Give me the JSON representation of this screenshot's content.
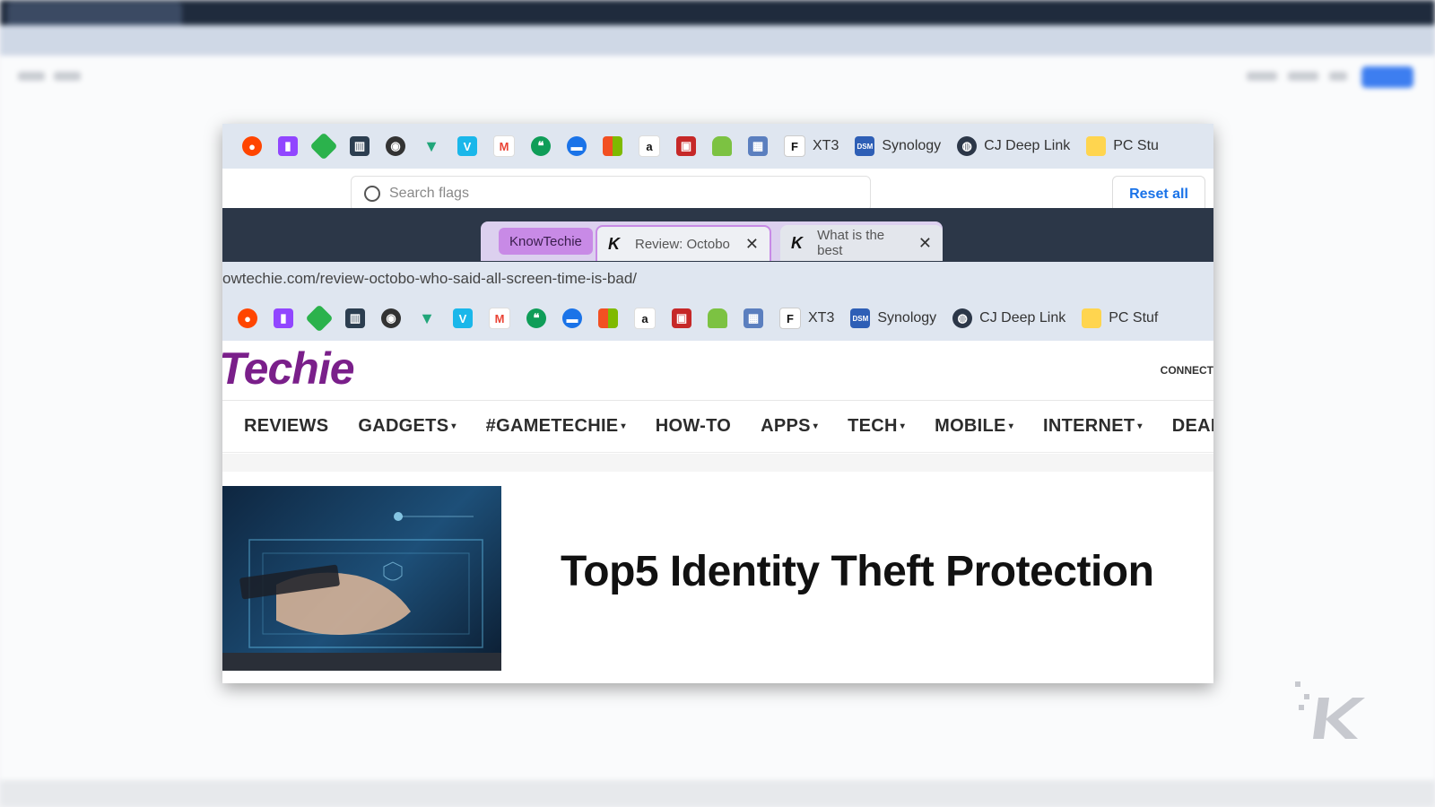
{
  "bookmarks_bar": {
    "icons": [
      "reddit-icon",
      "twitch-icon",
      "feedly-icon",
      "tiles-icon",
      "hootsuite-icon",
      "vuetify-icon",
      "vimeo-icon",
      "gmail-icon",
      "hangouts-icon",
      "chat-bubble-icon",
      "microsoft-icon",
      "amazon-icon",
      "gift-icon",
      "android-icon",
      "calendar-icon"
    ],
    "items": [
      {
        "icon": "f-icon",
        "label": "XT3"
      },
      {
        "icon": "dsm-icon",
        "label": "Synology"
      },
      {
        "icon": "globe-icon",
        "label": "CJ Deep Link"
      },
      {
        "icon": "folder-icon",
        "label": "PC Stu"
      }
    ],
    "colors": {
      "reddit": "#ff4500",
      "twitch": "#9146ff",
      "feedly": "#2bb24c",
      "gmail": "#ea4335",
      "vimeo": "#1ab7ea",
      "amazon": "#111111"
    }
  },
  "flags_page": {
    "search_placeholder": "Search flags",
    "reset_label": "Reset all"
  },
  "tab_strip": {
    "group_label": "KnowTechie",
    "group_color": "#c88ae6",
    "tabs": [
      {
        "title": "Review: Octobo",
        "close": "✕"
      },
      {
        "title": "What is the best",
        "close": "✕"
      }
    ]
  },
  "address_bar": {
    "url": "owtechie.com/review-octobo-who-said-all-screen-time-is-bad/"
  },
  "bookmarks_bar_2": {
    "items": [
      {
        "icon": "f-icon",
        "label": "XT3"
      },
      {
        "icon": "dsm-icon",
        "label": "Synology"
      },
      {
        "icon": "globe-icon",
        "label": "CJ Deep Link"
      },
      {
        "icon": "folder-icon",
        "label": "PC Stuf"
      }
    ]
  },
  "site": {
    "logo_text": "Techie",
    "logo_color": "#7a1f8a",
    "connect_label": "CONNECT",
    "nav": [
      {
        "label": "REVIEWS",
        "dropdown": false
      },
      {
        "label": "GADGETS",
        "dropdown": true
      },
      {
        "label": "#GAMETECHIE",
        "dropdown": true
      },
      {
        "label": "HOW-TO",
        "dropdown": false
      },
      {
        "label": "APPS",
        "dropdown": true
      },
      {
        "label": "TECH",
        "dropdown": true
      },
      {
        "label": "MOBILE",
        "dropdown": true
      },
      {
        "label": "INTERNET",
        "dropdown": true
      },
      {
        "label": "DEALS",
        "dropdown": false
      }
    ],
    "headline": "Top5 Identity Theft Protection"
  },
  "watermark_icon": "knowtechie-k-icon"
}
